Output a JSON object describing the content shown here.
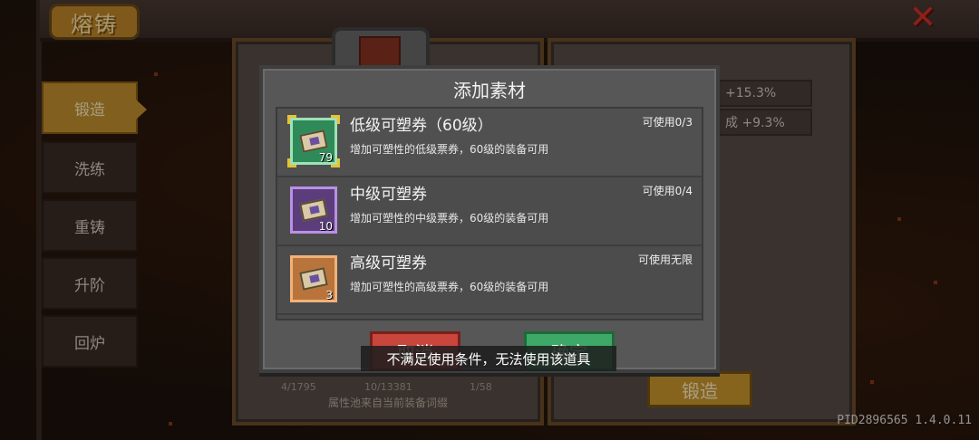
{
  "header": {
    "title": "熔铸",
    "close_icon": "close-x-icon"
  },
  "sidebar": {
    "tabs": [
      {
        "label": "锻造",
        "active": true
      },
      {
        "label": "洗练",
        "active": false
      },
      {
        "label": "重铸",
        "active": false
      },
      {
        "label": "升阶",
        "active": false
      },
      {
        "label": "回炉",
        "active": false
      }
    ]
  },
  "background": {
    "right_panel": {
      "stat1": "+15.3%",
      "stat2": "成 +9.3%",
      "forge_button": "锻造"
    },
    "left_panel": {
      "counts": [
        "4/1795",
        "10/13381",
        "1/58"
      ],
      "pool_text": "属性池来自当前装备词缀"
    }
  },
  "dialog": {
    "title": "添加素材",
    "items": [
      {
        "name": "低级可塑券（60级）",
        "description": "增加可塑性的低级票券，60级的装备可用",
        "availability": "可使用0/3",
        "quantity": "79",
        "rarity_color": "#2f8a5a",
        "selected": true,
        "icon": "ticket-icon"
      },
      {
        "name": "中级可塑券",
        "description": "增加可塑性的中级票券，60级的装备可用",
        "availability": "可使用0/4",
        "quantity": "10",
        "rarity_color": "#5a3d7a",
        "selected": false,
        "icon": "ticket-icon"
      },
      {
        "name": "高级可塑券",
        "description": "增加可塑性的高级票券，60级的装备可用",
        "availability": "可使用无限",
        "quantity": "3",
        "rarity_color": "#b8743a",
        "selected": false,
        "icon": "ticket-icon"
      }
    ],
    "cancel_label": "取消",
    "confirm_label": "确定"
  },
  "toast": "不满足使用条件，无法使用该道具",
  "pid": "PID2896565 1.4.0.11"
}
